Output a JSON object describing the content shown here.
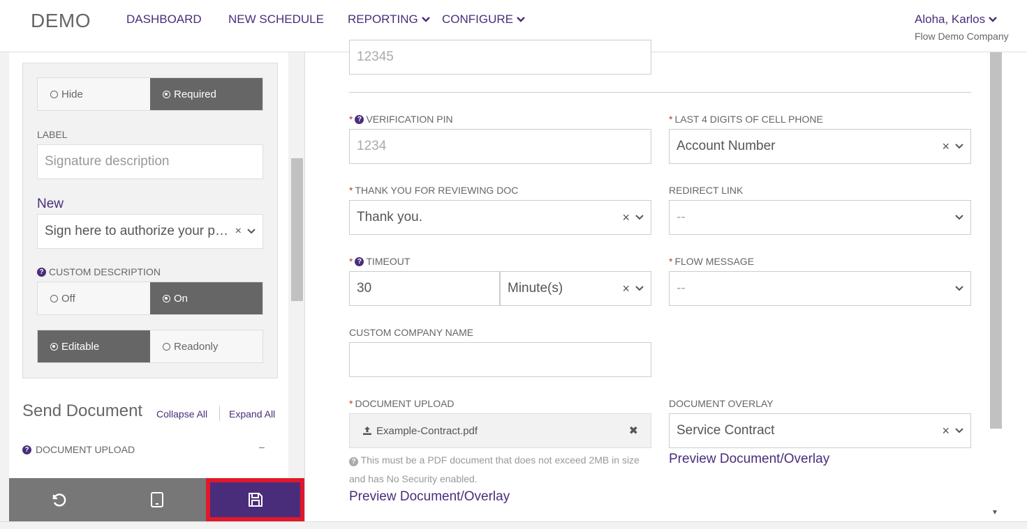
{
  "header": {
    "logo": "DEMO",
    "nav": [
      "DASHBOARD",
      "NEW SCHEDULE",
      "REPORTING",
      "CONFIGURE"
    ],
    "user": "Aloha, Karlos",
    "company": "Flow Demo Company"
  },
  "left": {
    "visibility": {
      "hide": "Hide",
      "required": "Required",
      "selected": "Required"
    },
    "label_title": "LABEL",
    "label_placeholder": "Signature description",
    "new_title": "New",
    "new_value": "Sign here to authorize your p…",
    "custom_desc_title": "CUSTOM DESCRIPTION",
    "custom_desc": {
      "off": "Off",
      "on": "On",
      "selected": "On"
    },
    "edit_mode": {
      "editable": "Editable",
      "readonly": "Readonly",
      "selected": "Editable"
    },
    "section_title": "Send Document",
    "collapse_all": "Collapse All",
    "expand_all": "Expand All",
    "doc_upload_label": "DOCUMENT UPLOAD",
    "doc_upload_toggle": "–"
  },
  "form": {
    "top_placeholder": "12345",
    "verification_pin": {
      "label": "VERIFICATION PIN",
      "placeholder": "1234"
    },
    "last4": {
      "label": "LAST 4 DIGITS OF CELL PHONE",
      "value": "Account Number"
    },
    "thank_you": {
      "label": "THANK YOU FOR REVIEWING DOC",
      "value": "Thank you."
    },
    "redirect": {
      "label": "REDIRECT LINK",
      "value": "--"
    },
    "timeout": {
      "label": "TIMEOUT",
      "value": "30",
      "unit": "Minute(s)"
    },
    "flow_message": {
      "label": "FLOW MESSAGE",
      "value": "--"
    },
    "custom_company": {
      "label": "CUSTOM COMPANY NAME",
      "value": ""
    },
    "doc_upload": {
      "label": "DOCUMENT UPLOAD",
      "file": "Example-Contract.pdf",
      "help": "This must be a PDF document that does not exceed 2MB in size and has No Security enabled."
    },
    "doc_overlay": {
      "label": "DOCUMENT OVERLAY",
      "value": "Service Contract"
    },
    "preview_link": "Preview Document/Overlay"
  },
  "colors": {
    "brand": "#4a2d7a",
    "save_highlight": "#e0182b",
    "required": "#c0392b"
  }
}
